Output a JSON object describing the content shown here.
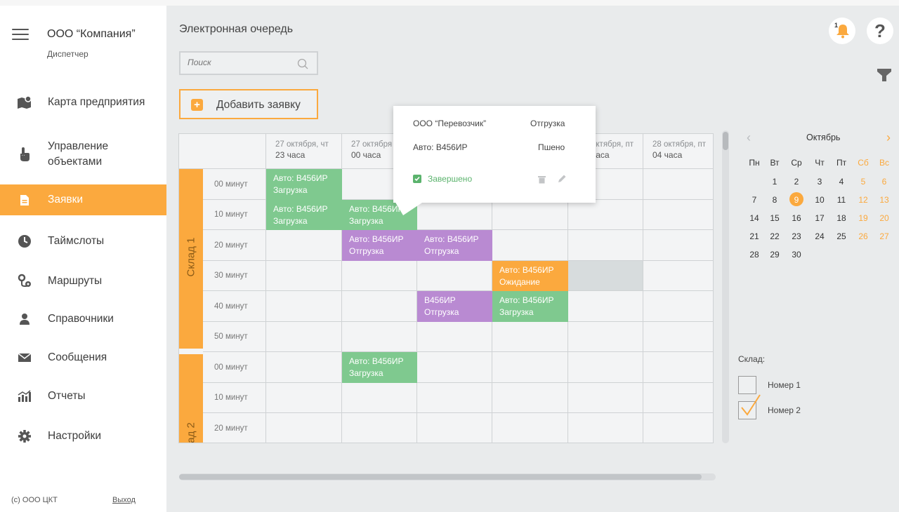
{
  "app": {
    "company": "ООО “Компания”",
    "role": "Диспетчер",
    "page_title": "Электронная очередь",
    "copyright": "(c) ООО ЦКТ",
    "logout": "Выход",
    "accent": "#fba93e"
  },
  "nav": [
    {
      "label": "Карта предприятия",
      "icon": "map-icon"
    },
    {
      "label": "Управление объектами",
      "icon": "hand-pointer-icon"
    },
    {
      "label": "Заявки",
      "icon": "document-icon",
      "active": true
    },
    {
      "label": "Таймслоты",
      "icon": "clock-icon"
    },
    {
      "label": "Маршруты",
      "icon": "route-pin-icon"
    },
    {
      "label": "Справочники",
      "icon": "person-icon"
    },
    {
      "label": "Сообщения",
      "icon": "envelope-icon"
    },
    {
      "label": "Отчеты",
      "icon": "bar-chart-icon"
    },
    {
      "label": "Настройки",
      "icon": "gear-icon"
    }
  ],
  "toolbar": {
    "search_placeholder": "Поиск",
    "add_label": "Добавить заявку",
    "bell_count": "1"
  },
  "grid": {
    "columns": [
      {
        "date": "27 октября, чт",
        "hour": "23 часа"
      },
      {
        "date": "27 октября",
        "hour": "00 часа"
      },
      {
        "date": "",
        "hour": ""
      },
      {
        "date": "",
        "hour": ""
      },
      {
        "date": "октября, пт",
        "hour": "часа"
      },
      {
        "date": "28 октября, пт",
        "hour": "04 часа"
      }
    ],
    "warehouses": [
      "Склад 1",
      "лад 2"
    ],
    "minutes": [
      "00 минут",
      "10 минут",
      "20 минут",
      "30 минут",
      "40 минут",
      "50 минут",
      "00 минут",
      "10 минут",
      "20 минут"
    ],
    "events": [
      {
        "line1": "Авто: В456ИР",
        "line2": "Загрузка"
      },
      {
        "line1": "Авто: В456ИР",
        "line2": "Загрузка"
      },
      {
        "line1": "Авто: В456ИР",
        "line2": "Загрузка"
      },
      {
        "line1": "Авто: В456ИР",
        "line2": "Отгрузка"
      },
      {
        "line1": "Авто: В456ИР",
        "line2": "Отгрузка"
      },
      {
        "line1": "Авто: В456ИР",
        "line2": "Ожидание"
      },
      {
        "line1": "В456ИР",
        "line2": "Отгрузка"
      },
      {
        "line1": "Авто: В456ИР",
        "line2": "Загрузка"
      },
      {
        "line1": "Авто: В456ИР",
        "line2": "Загрузка"
      }
    ],
    "colors": {
      "load": "#7fc98f",
      "ship": "#b98ad2",
      "wait": "#fba93e"
    }
  },
  "popup": {
    "carrier": "ООО “Перевозчик”",
    "type": "Отгрузка",
    "auto": "Авто: В456ИР",
    "cargo": "Пшено",
    "status": "Завершено"
  },
  "calendar": {
    "month": "Октябрь",
    "weekdays": [
      "Пн",
      "Вт",
      "Ср",
      "Чт",
      "Пт",
      "Сб",
      "Вс"
    ],
    "weeks": [
      [
        "",
        "1",
        "2",
        "3",
        "4",
        "5",
        "6"
      ],
      [
        "7",
        "8",
        "9",
        "10",
        "11",
        "12",
        "13"
      ],
      [
        "14",
        "15",
        "16",
        "17",
        "18",
        "19",
        "20"
      ],
      [
        "21",
        "22",
        "23",
        "24",
        "25",
        "26",
        "27"
      ],
      [
        "28",
        "29",
        "30",
        "",
        "",
        "",
        ""
      ]
    ],
    "selected_day": "9"
  },
  "warehouse_filter": {
    "label": "Склад:",
    "options": [
      {
        "label": "Номер 1",
        "checked": false
      },
      {
        "label": "Номер 2",
        "checked": true
      }
    ]
  }
}
